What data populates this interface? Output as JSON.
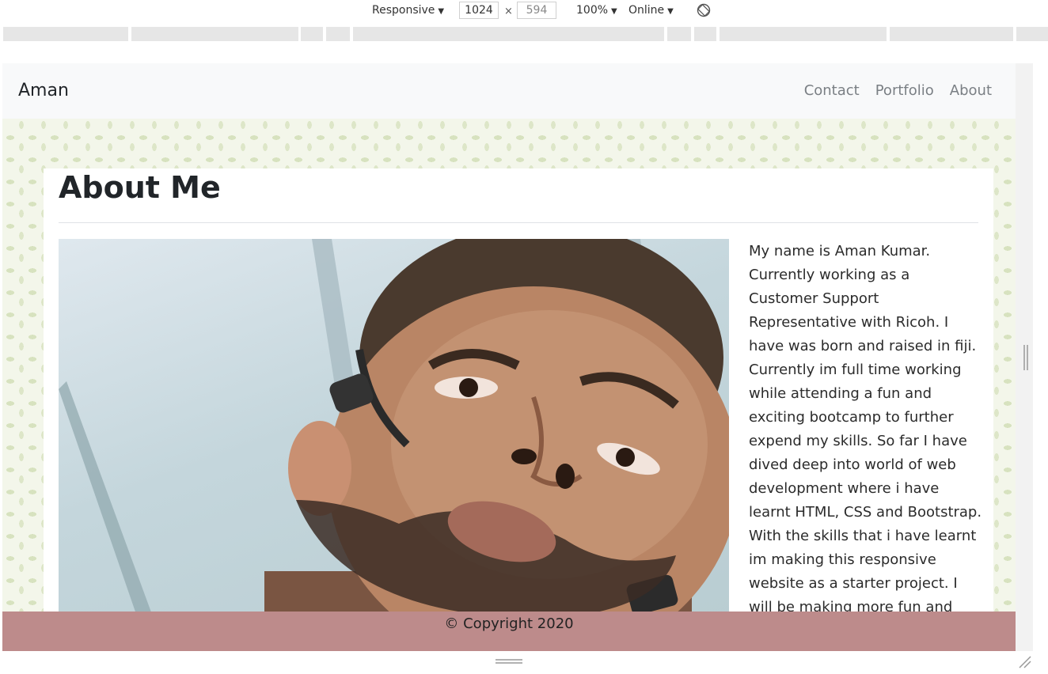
{
  "devtools": {
    "device_label": "Responsive",
    "width_value": "1024",
    "height_value": "594",
    "times": "×",
    "zoom_label": "100%",
    "throttle_label": "Online",
    "caret": "▼"
  },
  "navbar": {
    "brand": "Aman",
    "links": [
      {
        "label": "Contact"
      },
      {
        "label": "Portfolio"
      },
      {
        "label": "About"
      }
    ]
  },
  "main": {
    "title": "About Me",
    "bio": "My name is Aman Kumar. Currently working as a Customer Support Representative with Ricoh. I have was born and raised in fiji. Currently im full time working while attending a fun and exciting bootcamp to further expend my skills. So far I have dived deep into world of web development where i have learnt HTML, CSS and Bootstrap. With the skills that i have learnt im making this responsive website as a starter project. I will be making more fun and interactive websites once I have"
  },
  "footer": {
    "copyright": "© Copyright 2020"
  },
  "icons": {
    "rotate": "rotate-icon",
    "resize": "resize-handle-icon"
  },
  "colors": {
    "footer_bg": "#bd8b8b",
    "navbar_bg": "#f8f9fa",
    "nav_link": "#7a7f84"
  }
}
